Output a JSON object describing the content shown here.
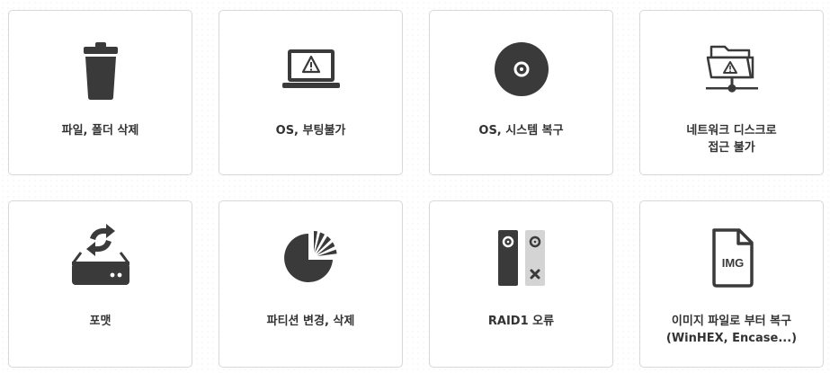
{
  "cards": [
    {
      "label": "파일, 폴더 삭제",
      "icon": "trash-icon"
    },
    {
      "label": "OS, 부팅불가",
      "icon": "laptop-warning-icon"
    },
    {
      "label": "OS, 시스템 복구",
      "icon": "disc-icon"
    },
    {
      "label": "네트워크 디스크로\n접근 불가",
      "icon": "network-folder-warning-icon"
    },
    {
      "label": "포맷",
      "icon": "drive-sync-icon"
    },
    {
      "label": "파티션 변경, 삭제",
      "icon": "pie-chart-icon"
    },
    {
      "label": "RAID1 오류",
      "icon": "raid-drives-icon"
    },
    {
      "label": "이미지 파일로 부터 복구\n(WinHEX, Encase...)",
      "icon": "img-file-icon"
    }
  ],
  "img_icon_text": "IMG",
  "colors": {
    "icon": "#3a3a3a",
    "border": "#d8d8d8",
    "text": "#333333"
  }
}
